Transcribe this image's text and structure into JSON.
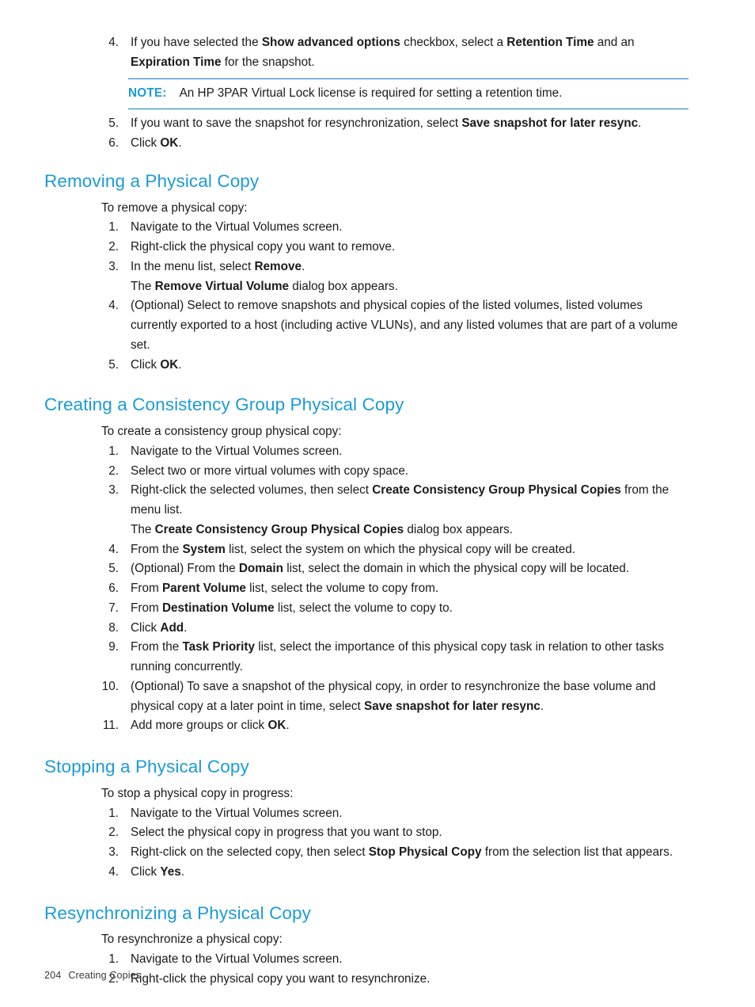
{
  "page": {
    "footer_page_number": "204",
    "footer_chapter": "Creating Copies",
    "heading_color": "#1b9bd8",
    "note_rule_color": "#0e7fb8",
    "body_color": "#1a1a1a"
  },
  "top_steps": {
    "items": [
      {
        "num": "4.",
        "parts": [
          {
            "t": "If you have selected the ",
            "b": false
          },
          {
            "t": "Show advanced options",
            "b": true
          },
          {
            "t": " checkbox, select a ",
            "b": false
          },
          {
            "t": "Retention Time",
            "b": true
          },
          {
            "t": " and an ",
            "b": false
          },
          {
            "t": "Expiration Time",
            "b": true
          },
          {
            "t": " for the snapshot.",
            "b": false
          }
        ]
      },
      {
        "num": "5.",
        "parts": [
          {
            "t": "If you want to save the snapshot for resynchronization, select ",
            "b": false
          },
          {
            "t": "Save snapshot for later resync",
            "b": true
          },
          {
            "t": ".",
            "b": false
          }
        ]
      },
      {
        "num": "6.",
        "parts": [
          {
            "t": "Click ",
            "b": false
          },
          {
            "t": "OK",
            "b": true
          },
          {
            "t": ".",
            "b": false
          }
        ]
      }
    ]
  },
  "note": {
    "label": "NOTE:",
    "text": "An HP 3PAR Virtual Lock license is required for setting a retention time."
  },
  "sections": [
    {
      "id": "removing-a-physical-copy",
      "heading": "Removing a Physical Copy",
      "lead": "To remove a physical copy:",
      "items": [
        {
          "num": "1.",
          "parts": [
            {
              "t": "Navigate to the Virtual Volumes screen.",
              "b": false
            }
          ]
        },
        {
          "num": "2.",
          "parts": [
            {
              "t": "Right-click the physical copy you want to remove.",
              "b": false
            }
          ]
        },
        {
          "num": "3.",
          "parts": [
            {
              "t": "In the menu list, select ",
              "b": false
            },
            {
              "t": "Remove",
              "b": true
            },
            {
              "t": ".",
              "b": false
            }
          ],
          "follow": [
            {
              "t": "The ",
              "b": false
            },
            {
              "t": "Remove Virtual Volume",
              "b": true
            },
            {
              "t": " dialog box appears.",
              "b": false
            }
          ]
        },
        {
          "num": "4.",
          "parts": [
            {
              "t": "(Optional) Select to remove snapshots and physical copies of the listed volumes, listed volumes currently exported to a host (including active VLUNs), and any listed volumes that are part of a volume set.",
              "b": false
            }
          ]
        },
        {
          "num": "5.",
          "parts": [
            {
              "t": "Click ",
              "b": false
            },
            {
              "t": "OK",
              "b": true
            },
            {
              "t": ".",
              "b": false
            }
          ]
        }
      ]
    },
    {
      "id": "creating-a-consistency-group-physical-copy",
      "heading": "Creating a Consistency Group Physical Copy",
      "lead": "To create a consistency group physical copy:",
      "items": [
        {
          "num": "1.",
          "parts": [
            {
              "t": "Navigate to the Virtual Volumes screen.",
              "b": false
            }
          ]
        },
        {
          "num": "2.",
          "parts": [
            {
              "t": "Select two or more virtual volumes with copy space.",
              "b": false
            }
          ]
        },
        {
          "num": "3.",
          "parts": [
            {
              "t": "Right-click the selected volumes, then select ",
              "b": false
            },
            {
              "t": "Create Consistency Group Physical Copies",
              "b": true
            },
            {
              "t": " from the menu list.",
              "b": false
            }
          ],
          "follow": [
            {
              "t": "The ",
              "b": false
            },
            {
              "t": "Create Consistency Group Physical Copies",
              "b": true
            },
            {
              "t": " dialog box appears.",
              "b": false
            }
          ]
        },
        {
          "num": "4.",
          "parts": [
            {
              "t": "From the ",
              "b": false
            },
            {
              "t": "System",
              "b": true
            },
            {
              "t": " list, select the system on which the physical copy will be created.",
              "b": false
            }
          ]
        },
        {
          "num": "5.",
          "parts": [
            {
              "t": "(Optional) From the ",
              "b": false
            },
            {
              "t": "Domain",
              "b": true
            },
            {
              "t": " list, select the domain in which the physical copy will be located.",
              "b": false
            }
          ]
        },
        {
          "num": "6.",
          "parts": [
            {
              "t": "From ",
              "b": false
            },
            {
              "t": "Parent Volume",
              "b": true
            },
            {
              "t": " list, select the volume to copy from.",
              "b": false
            }
          ]
        },
        {
          "num": "7.",
          "parts": [
            {
              "t": "From ",
              "b": false
            },
            {
              "t": "Destination Volume",
              "b": true
            },
            {
              "t": " list, select the volume to copy to.",
              "b": false
            }
          ]
        },
        {
          "num": "8.",
          "parts": [
            {
              "t": "Click ",
              "b": false
            },
            {
              "t": "Add",
              "b": true
            },
            {
              "t": ".",
              "b": false
            }
          ]
        },
        {
          "num": "9.",
          "parts": [
            {
              "t": "From the ",
              "b": false
            },
            {
              "t": "Task Priority",
              "b": true
            },
            {
              "t": " list, select the importance of this physical copy task in relation to other tasks running concurrently.",
              "b": false
            }
          ]
        },
        {
          "num": "10.",
          "parts": [
            {
              "t": "(Optional) To save a snapshot of the physical copy, in order to resynchronize the base volume and physical copy at a later point in time, select ",
              "b": false
            },
            {
              "t": "Save snapshot for later resync",
              "b": true
            },
            {
              "t": ".",
              "b": false
            }
          ]
        },
        {
          "num": "11.",
          "parts": [
            {
              "t": "Add more groups or click ",
              "b": false
            },
            {
              "t": "OK",
              "b": true
            },
            {
              "t": ".",
              "b": false
            }
          ]
        }
      ]
    },
    {
      "id": "stopping-a-physical-copy",
      "heading": "Stopping a Physical Copy",
      "lead": "To stop a physical copy in progress:",
      "items": [
        {
          "num": "1.",
          "parts": [
            {
              "t": "Navigate to the Virtual Volumes screen.",
              "b": false
            }
          ]
        },
        {
          "num": "2.",
          "parts": [
            {
              "t": "Select the physical copy in progress that you want to stop.",
              "b": false
            }
          ]
        },
        {
          "num": "3.",
          "parts": [
            {
              "t": "Right-click on the selected copy, then select ",
              "b": false
            },
            {
              "t": "Stop Physical Copy",
              "b": true
            },
            {
              "t": " from the selection list that appears.",
              "b": false
            }
          ]
        },
        {
          "num": "4.",
          "parts": [
            {
              "t": "Click ",
              "b": false
            },
            {
              "t": "Yes",
              "b": true
            },
            {
              "t": ".",
              "b": false
            }
          ]
        }
      ]
    },
    {
      "id": "resynchronizing-a-physical-copy",
      "heading": "Resynchronizing a Physical Copy",
      "lead": "To resynchronize a physical copy:",
      "items": [
        {
          "num": "1.",
          "parts": [
            {
              "t": "Navigate to the Virtual Volumes screen.",
              "b": false
            }
          ]
        },
        {
          "num": "2.",
          "parts": [
            {
              "t": "Right-click the physical copy you want to resynchronize.",
              "b": false
            }
          ]
        }
      ]
    }
  ]
}
